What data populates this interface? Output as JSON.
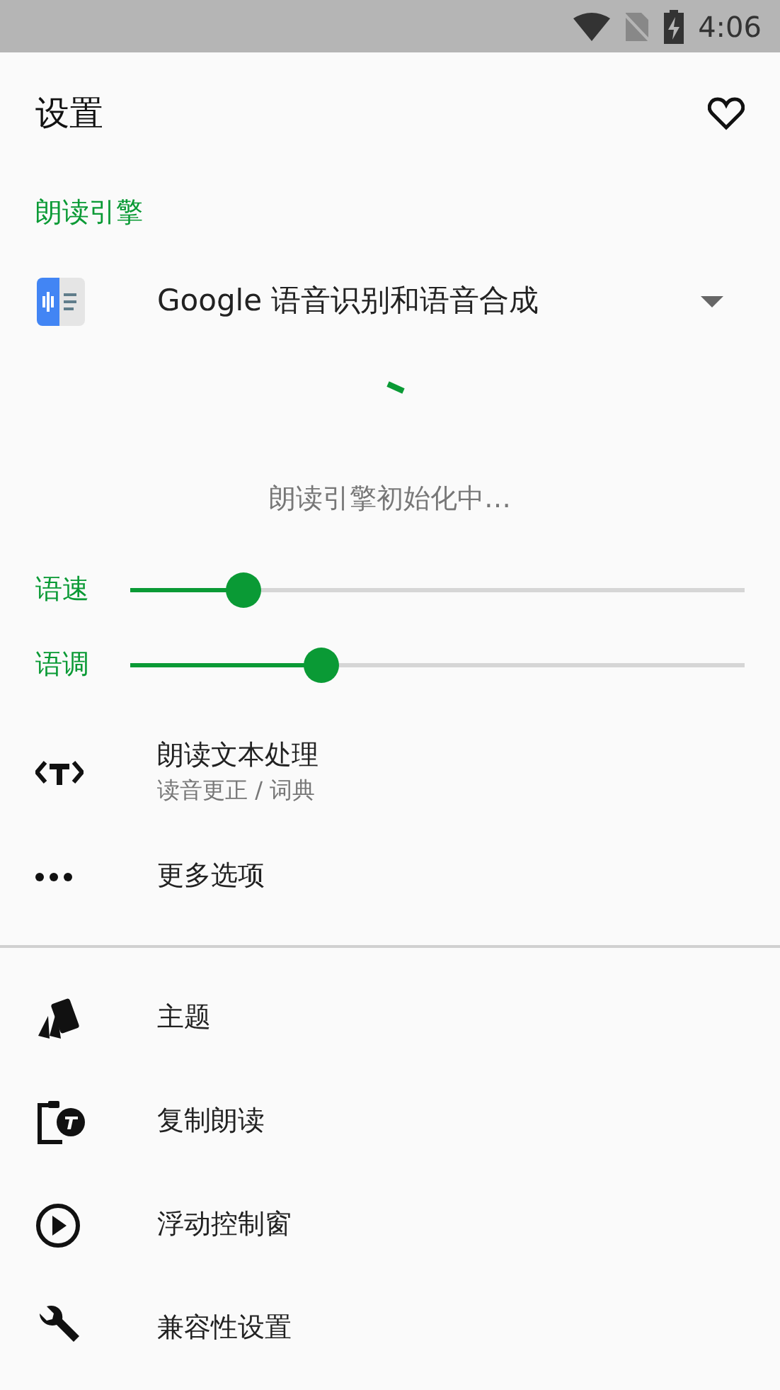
{
  "status_bar": {
    "time": "4:06"
  },
  "title": "设置",
  "section": "朗读引擎",
  "engine": {
    "name": "Google 语音识别和语音合成"
  },
  "engine_status": "朗读引擎初始化中…",
  "sliders": [
    {
      "label": "语速",
      "level": 0.184
    },
    {
      "label": "语调",
      "level": 0.311
    }
  ],
  "group_1": [
    {
      "kind": "text-processing",
      "title": "朗读文本处理",
      "subtitle": "读音更正 / 词典"
    },
    {
      "kind": "more",
      "title": "更多选项"
    }
  ],
  "group_2": [
    {
      "kind": "theme",
      "title": "主题"
    },
    {
      "kind": "copy-read",
      "title": "复制朗读"
    },
    {
      "kind": "floating",
      "title": "浮动控制窗"
    },
    {
      "kind": "compat",
      "title": "兼容性设置"
    }
  ]
}
